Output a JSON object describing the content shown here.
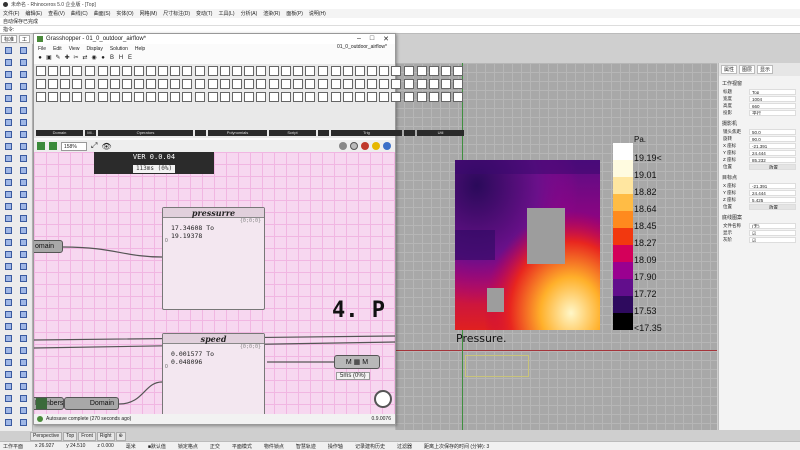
{
  "rhino": {
    "title": "未命名 - Rhinoceros 5.0 企业版 - [Top]",
    "menu": [
      "文件(F)",
      "编辑(E)",
      "查看(V)",
      "曲线(C)",
      "曲面(S)",
      "实体(O)",
      "网格(M)",
      "尺寸标注(D)",
      "变动(T)",
      "工具(L)",
      "分析(A)",
      "渲染(R)",
      "面板(P)",
      "说明(H)"
    ],
    "cmd_history": "自动保存已完成",
    "cmd_prompt": "指令:",
    "top_tabs": [
      "标准",
      "工"
    ],
    "viewport_tabs": [
      "Perspective",
      "Top",
      "Front",
      "Right",
      "⊕"
    ],
    "status": [
      "工作平面",
      "x 26.927",
      "y 24.510",
      "z 0.000",
      "毫米",
      "■默认值",
      "锁定格点",
      "正交",
      "平面模式",
      "物件锁点",
      "智慧轨迹",
      "操作轴",
      "记录建构历史",
      "过滤器",
      "距离上次保存的时间 (分钟): 3"
    ]
  },
  "properties": {
    "tabs": [
      "属性",
      "图层",
      "显示"
    ],
    "section_view": "工作视窗",
    "rows1": [
      [
        "标题",
        "Top"
      ],
      [
        "宽度",
        "1004"
      ],
      [
        "高度",
        "660"
      ],
      [
        "投影",
        "平行"
      ]
    ],
    "section_camera": "摄影机",
    "rows2": [
      [
        "镜头焦距",
        "50.0"
      ],
      [
        "旋转",
        "90.0"
      ],
      [
        "X 座标",
        "-21.391"
      ],
      [
        "Y 座标",
        "24.444"
      ],
      [
        "Z 座标",
        "85.232"
      ],
      [
        "位置",
        "放置"
      ]
    ],
    "section_target": "目标点",
    "rows3": [
      [
        "X 座标",
        "-21.391"
      ],
      [
        "Y 座标",
        "24.444"
      ],
      [
        "Z 座标",
        "5.425"
      ],
      [
        "位置",
        "放置"
      ]
    ],
    "section_bg": "底线图案",
    "rows4": [
      [
        "文件名称",
        "(无)"
      ],
      [
        "显示",
        "☑"
      ],
      [
        "灰阶",
        "☑"
      ]
    ]
  },
  "gh": {
    "title": "Grasshopper - 01_0_outdoor_airflow*",
    "doc_title": "01_0_outdoor_airflow*",
    "menu": [
      "File",
      "Edit",
      "View",
      "Display",
      "Solution",
      "Help"
    ],
    "toolbar_glyphs": [
      "●",
      "▣",
      "✎",
      "✚",
      "✂",
      "⇄",
      "◉",
      "●",
      "B",
      "H",
      "E"
    ],
    "ribbon_groups": [
      "Domain",
      "Ml..",
      "Operators",
      "",
      "Polynomials",
      "Script",
      "",
      "Trig",
      "",
      "Util"
    ],
    "zoom": "158%",
    "status": "Autosave complete (270 seconds ago)",
    "status_value": "0.9.0076",
    "version_box": "VER 0.0.04",
    "version_time": "113ms (0%)",
    "big_text": "4. P",
    "nodes": {
      "pressure": {
        "title": "pressurre",
        "path": "{0;0;0}",
        "index": "0",
        "value": "17.34608 To\n19.19378"
      },
      "speed": {
        "title": "speed",
        "path": "{0;0;0}",
        "index": "0",
        "value": "0.001577 To\n0.048096"
      }
    },
    "pills": {
      "domain1": "omain",
      "numbers": "Numbers",
      "domain2": "Domain",
      "mm": "M ▦ M",
      "mm_time": "5ms (0%)"
    }
  },
  "heatmap": {
    "title": "Pressure.",
    "unit": "Pa.",
    "legend_labels": [
      "19.19<",
      "19.01",
      "18.82",
      "18.64",
      "18.45",
      "18.27",
      "18.09",
      "17.90",
      "17.72",
      "17.53",
      "<17.35"
    ],
    "legend_colors": [
      "#ffffff",
      "#fffbe0",
      "#ffe6a0",
      "#ffbc45",
      "#ff8a1e",
      "#f2380f",
      "#d4005a",
      "#9a0090",
      "#620e8c",
      "#2e0a5e",
      "#000000"
    ]
  }
}
